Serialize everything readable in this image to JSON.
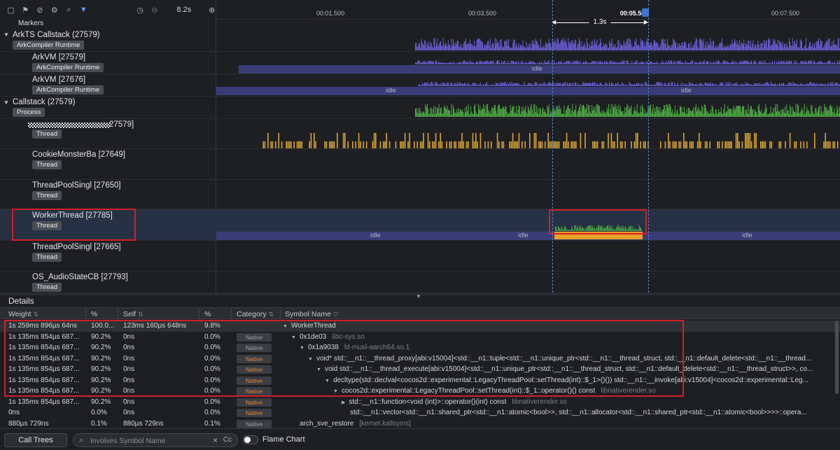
{
  "toolbar": {
    "zoom": "8.2s"
  },
  "ruler": {
    "ticks": [
      "00:01.500",
      "00:03.500",
      "00:05.500",
      "00:07.500"
    ],
    "selection_duration": "1.3s"
  },
  "markers_label": "Markers",
  "rows": [
    {
      "name": "ArkTS Callstack (27579)",
      "tag": "ArkCompiler Runtime"
    },
    {
      "name": "ArkVM [27579]",
      "tag": "ArkCompiler Runtime"
    },
    {
      "name": "ArkVM [27676]",
      "tag": "ArkCompiler Runtime"
    },
    {
      "name": "Callstack (27579)",
      "tag": "Process"
    },
    {
      "name": "27579]",
      "tag": "Thread"
    },
    {
      "name": "CookieMonsterBa [27649]",
      "tag": "Thread"
    },
    {
      "name": "ThreadPoolSingl [27650]",
      "tag": "Thread"
    },
    {
      "name": "WorkerThread [27785]",
      "tag": "Thread"
    },
    {
      "name": "ThreadPoolSingl [27665]",
      "tag": "Thread"
    },
    {
      "name": "OS_AudioStateCB [27793]",
      "tag": "Thread"
    }
  ],
  "idle_label": "idle",
  "colors": {
    "purple": "#6b5fd6",
    "green": "#4fae45",
    "yellow": "#d9a434",
    "orange": "#e8a126",
    "idle_band": "#3a3c78",
    "selection": "#d21f2a"
  },
  "details": {
    "title": "Details",
    "headers": {
      "weight": "Weight",
      "pct": "%",
      "self": "Self",
      "self_pct": "%",
      "category": "Category",
      "symbol": "Symbol Name"
    },
    "rows": [
      {
        "weight": "1s 259ms 896µs 64ns",
        "pct": "100.0...",
        "self": "123ms 160µs 648ns",
        "self_pct": "9.8%",
        "category": "",
        "symbol": "WorkerThread",
        "lib": "",
        "indent": 0,
        "caret": "down"
      },
      {
        "weight": "1s 135ms 854µs 687...",
        "pct": "90.2%",
        "self": "0ns",
        "self_pct": "0.0%",
        "category": "Native",
        "symbol": "0x1de03",
        "lib": "libc-sys.so",
        "indent": 1,
        "caret": "down"
      },
      {
        "weight": "1s 135ms 854µs 687...",
        "pct": "90.2%",
        "self": "0ns",
        "self_pct": "0.0%",
        "category": "Native",
        "symbol": "0x1a9038",
        "lib": "ld-musl-aarch64.so.1",
        "indent": 2,
        "caret": "down"
      },
      {
        "weight": "1s 135ms 854µs 687...",
        "pct": "90.2%",
        "self": "0ns",
        "self_pct": "0.0%",
        "category": "Native",
        "symbol": "void* std::__n1::__thread_proxy[abi:v15004]<std::__n1::tuple<std::__n1::unique_ptr<std::__n1::__thread_struct, std::__n1::default_delete<std::__n1::__thread...",
        "lib": "",
        "indent": 3,
        "caret": "down"
      },
      {
        "weight": "1s 135ms 854µs 687...",
        "pct": "90.2%",
        "self": "0ns",
        "self_pct": "0.0%",
        "category": "Native",
        "symbol": "void std::__n1::__thread_execute[abi:v15004]<std::__n1::unique_ptr<std::__n1::__thread_struct, std::__n1::default_delete<std::__n1::__thread_struct>>, co...",
        "lib": "",
        "indent": 4,
        "caret": "down"
      },
      {
        "weight": "1s 135ms 854µs 687...",
        "pct": "90.2%",
        "self": "0ns",
        "self_pct": "0.0%",
        "category": "Native",
        "symbol": "decltype(std::declval<cocos2d::experimental::LegacyThreadPool::setThread(int)::$_1>()()) std::__n1::__invoke[abi:v15004]<cocos2d::experimental::Leg...",
        "lib": "",
        "indent": 5,
        "caret": "down"
      },
      {
        "weight": "1s 135ms 854µs 687...",
        "pct": "90.2%",
        "self": "0ns",
        "self_pct": "0.0%",
        "category": "Native",
        "symbol": "cocos2d::experimental::LegacyThreadPool::setThread(int)::$_1::operator()() const",
        "lib": "libnativerender.so",
        "indent": 6,
        "caret": "down"
      },
      {
        "weight": "1s 135ms 854µs 687...",
        "pct": "90.2%",
        "self": "0ns",
        "self_pct": "0.0%",
        "category": "Native",
        "symbol": "std::__n1::function<void (int)>::operator()(int) const",
        "lib": "libnativerender.so",
        "indent": 7,
        "caret": "right"
      },
      {
        "weight": "0ns",
        "pct": "0.0%",
        "self": "0ns",
        "self_pct": "0.0%",
        "category": "Native",
        "symbol": "std::__n1::vector<std::__n1::shared_ptr<std::__n1::atomic<bool>>, std::__n1::allocator<std::__n1::shared_ptr<std::__n1::atomic<bool>>>>::opera...",
        "lib": "",
        "indent": 7,
        "caret": ""
      },
      {
        "weight": "880µs 729ns",
        "pct": "0.1%",
        "self": "880µs 729ns",
        "self_pct": "0.1%",
        "category": "Native",
        "symbol": "arch_sve_restore",
        "lib": "[kernel.kallsyms]",
        "indent": 1,
        "caret": ""
      }
    ]
  },
  "bottom": {
    "call_trees": "Call Trees",
    "search_placeholder": "Involves Symbol Name",
    "cc": "Cc",
    "flame_chart": "Flame Chart"
  }
}
